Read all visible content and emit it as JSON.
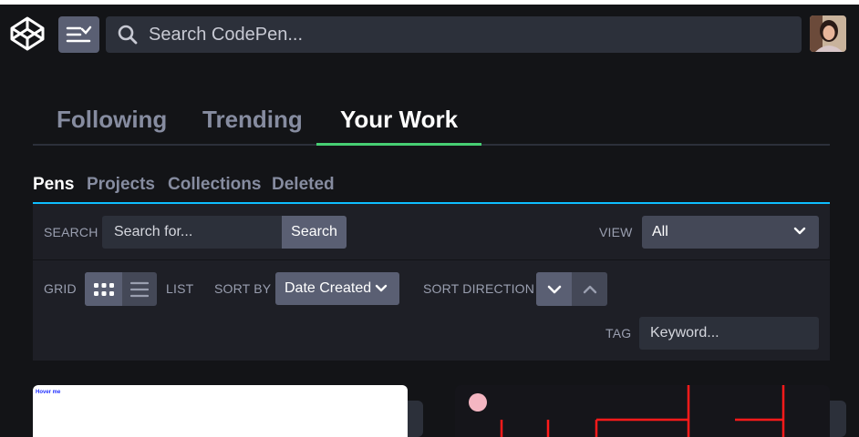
{
  "header": {
    "search_placeholder": "Search CodePen...",
    "icons": {
      "logo": "codepen-logo-icon",
      "menu": "menu-toggle-icon",
      "search": "search-icon"
    }
  },
  "main_tabs": [
    {
      "label": "Following",
      "active": false
    },
    {
      "label": "Trending",
      "active": false
    },
    {
      "label": "Your Work",
      "active": true
    }
  ],
  "sub_tabs": [
    {
      "label": "Pens",
      "active": true
    },
    {
      "label": "Projects",
      "active": false
    },
    {
      "label": "Collections",
      "active": false
    },
    {
      "label": "Deleted",
      "active": false
    }
  ],
  "filters": {
    "search_label": "SEARCH",
    "search_placeholder": "Search for...",
    "search_button": "Search",
    "view_label": "VIEW",
    "view_value": "All",
    "grid_label": "GRID",
    "list_label": "LIST",
    "sort_by_label": "SORT BY",
    "sort_by_value": "Date Created",
    "sort_direction_label": "SORT DIRECTION",
    "tag_label": "TAG",
    "tag_placeholder": "Keyword..."
  },
  "cards": [
    {
      "preview_text": "Hover me"
    },
    {
      "preview_text": ""
    }
  ],
  "colors": {
    "accent_green": "#47cf73",
    "accent_blue": "#0ebeff",
    "maze_red": "#ff1a1a",
    "ball_pink": "#f4b6c2"
  }
}
